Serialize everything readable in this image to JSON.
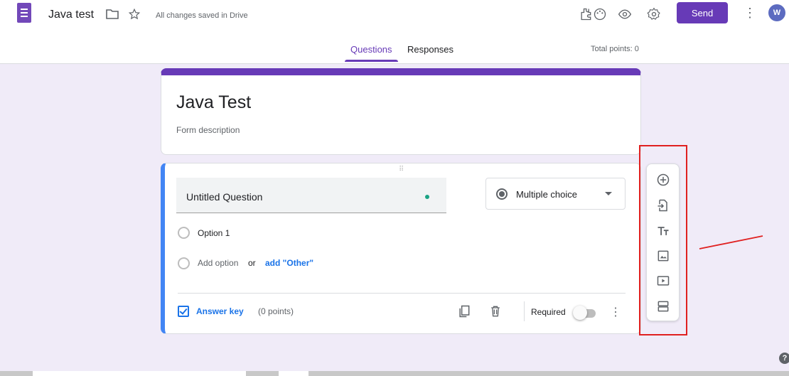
{
  "header": {
    "doc_title": "Java test",
    "saved_status": "All changes saved in Drive",
    "send_label": "Send",
    "avatar_letter": "W",
    "more_glyph": "⋮"
  },
  "tabs": {
    "questions": "Questions",
    "responses": "Responses",
    "total_points": "Total points: 0"
  },
  "form": {
    "title": "Java Test",
    "description_placeholder": "Form description"
  },
  "question": {
    "drag_glyph": "⠿",
    "title": "Untitled Question",
    "type": "Multiple choice",
    "options": [
      "Option 1"
    ],
    "add_option": "Add option",
    "or_text": "or",
    "add_other": "add \"Other\"",
    "answer_key": "Answer key",
    "points": "(0 points)",
    "required_label": "Required",
    "required": false,
    "more_glyph": "⋮"
  },
  "toolbar": {
    "items": [
      "add-question-icon",
      "import-questions-icon",
      "add-title-icon",
      "add-image-icon",
      "add-video-icon",
      "add-section-icon"
    ]
  },
  "help_glyph": "?",
  "colors": {
    "accent": "#673ab7",
    "background": "#f0ebf8",
    "highlight": "#e02020",
    "link": "#1a73e8"
  }
}
